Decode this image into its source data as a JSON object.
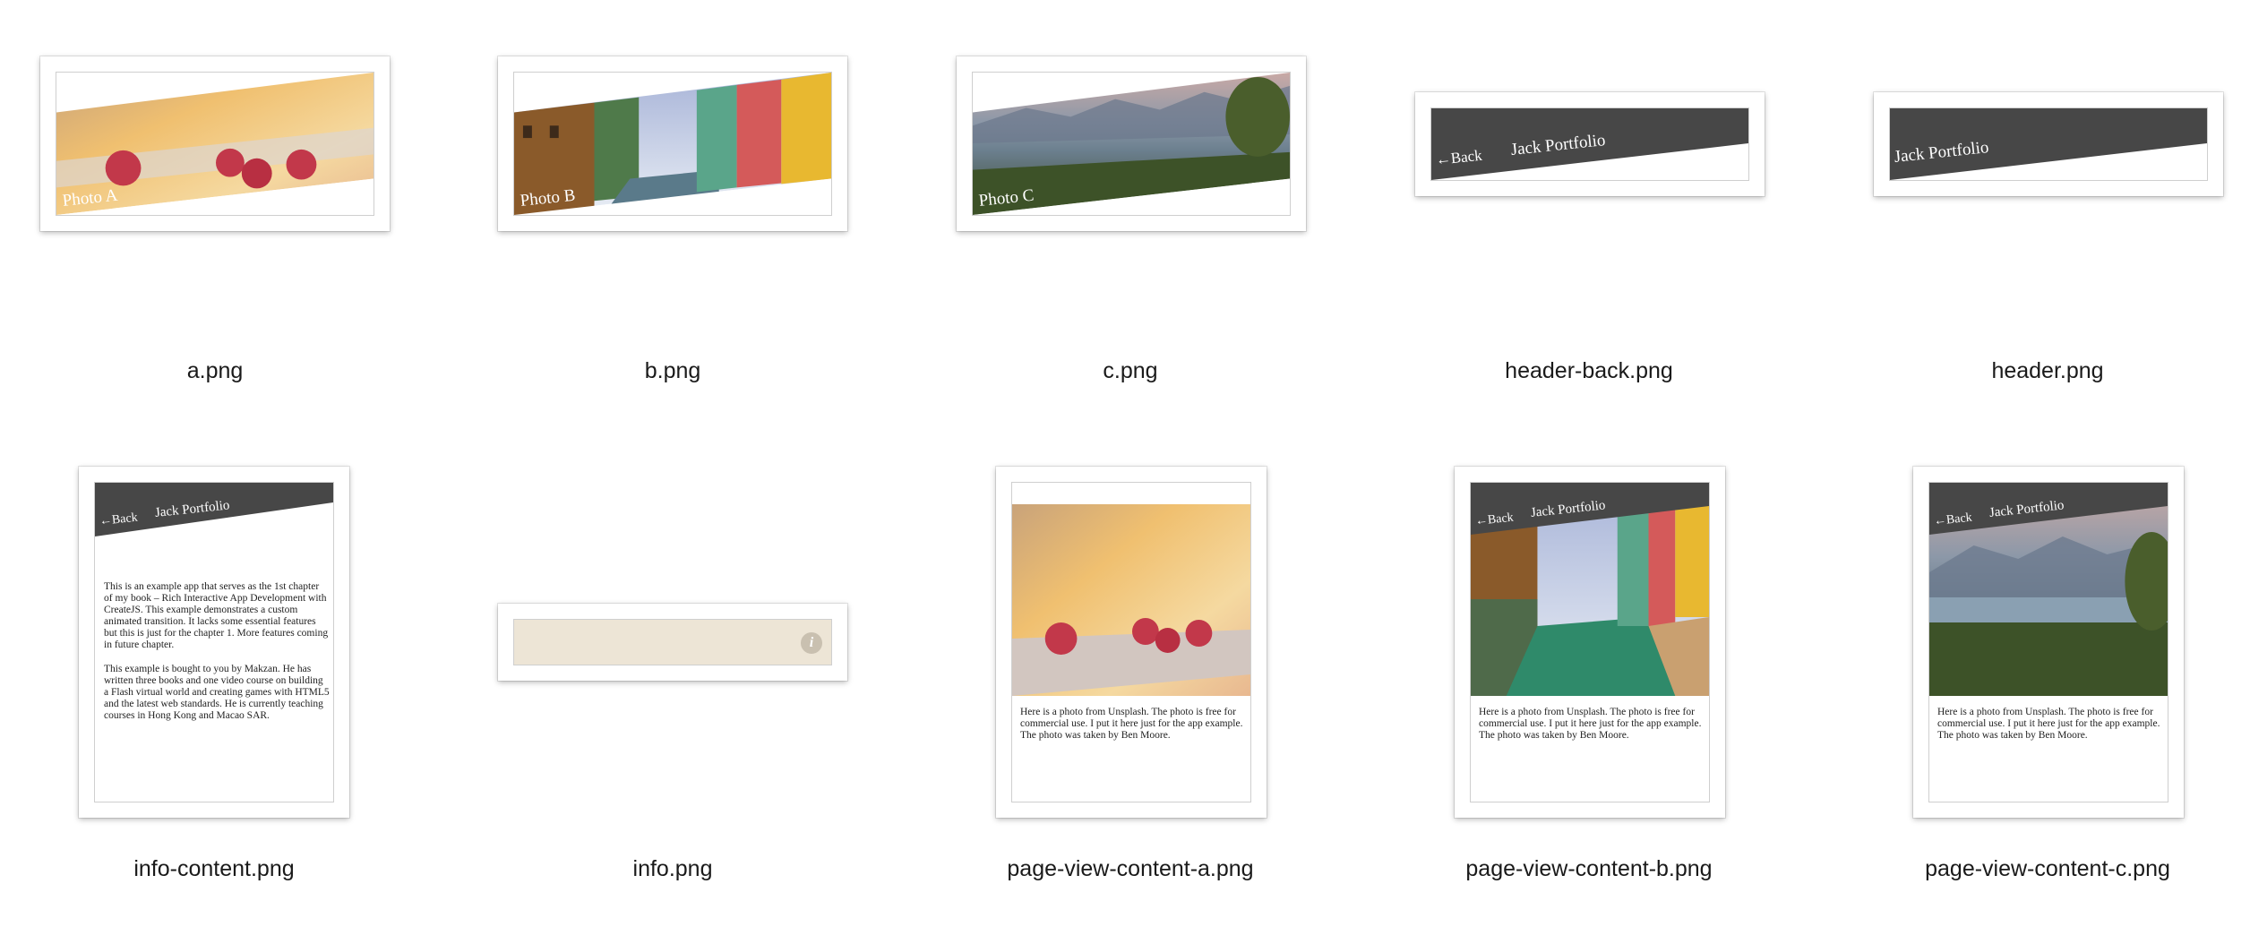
{
  "files": [
    {
      "name": "a.png",
      "overlay": "Photo A"
    },
    {
      "name": "b.png",
      "overlay": "Photo B"
    },
    {
      "name": "c.png",
      "overlay": "Photo C"
    },
    {
      "name": "header-back.png",
      "back": "←Back",
      "title": "Jack Portfolio"
    },
    {
      "name": "header.png",
      "title": "Jack Portfolio"
    },
    {
      "name": "info-content.png",
      "back": "←Back",
      "title": "Jack Portfolio",
      "para1": "This is an example app that serves as the 1st chapter of my book – Rich Interactive App Development with CreateJS. This example demonstrates a custom animated transition. It lacks some essential features but this is just for the chapter 1. More features coming in future chapter.",
      "para2": "This example is bought to you by Makzan. He has written three books and one video course on building a Flash virtual world and creating games with HTML5 and the latest web standards. He is currently teaching courses in Hong Kong and Macao SAR."
    },
    {
      "name": "info.png",
      "icon": "info-icon"
    },
    {
      "name": "page-view-content-a.png",
      "caption": "Here is a photo from Unsplash. The photo is free for commercial use. I put it here just for the app example. The photo was taken by Ben Moore."
    },
    {
      "name": "page-view-content-b.png",
      "back": "←Back",
      "title": "Jack Portfolio",
      "caption": "Here is a photo from Unsplash. The photo is free for commercial use. I put it here just for the app example. The photo was taken by Ben Moore."
    },
    {
      "name": "page-view-content-c.png",
      "back": "←Back",
      "title": "Jack Portfolio",
      "caption": "Here is a photo from Unsplash. The photo is free for commercial use. I put it here just for the app example. The photo was taken by Ben Moore."
    }
  ],
  "colors": {
    "header": "#474747",
    "info_bg": "#ede5d6",
    "info_icon": "#c9c0b0"
  }
}
